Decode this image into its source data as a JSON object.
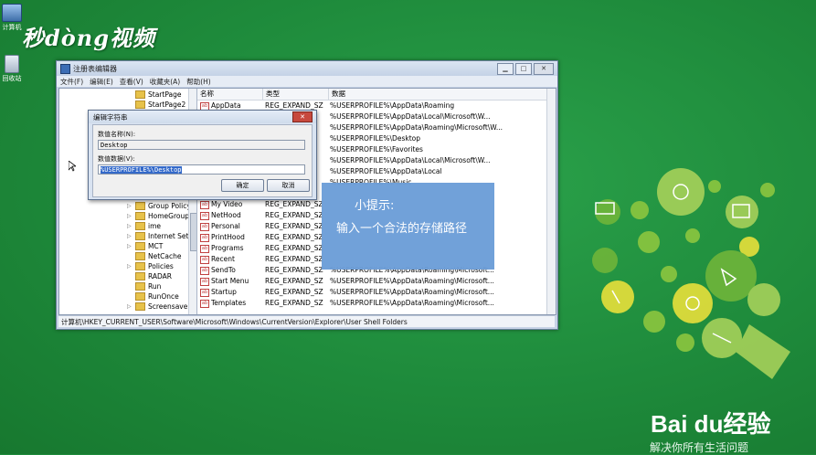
{
  "desktop": {
    "icons": [
      {
        "label": "计算机",
        "icon": "computer-icon"
      },
      {
        "label": "回收站",
        "icon": "recycle-bin-icon"
      }
    ],
    "logo_text": "秒dòng视频",
    "baidu_brand": "Bai du经验",
    "baidu_slogan": "解决你所有生活问题"
  },
  "window": {
    "title": "注册表编辑器",
    "menu": [
      "文件(F)",
      "编辑(E)",
      "查看(V)",
      "收藏夹(A)",
      "帮助(H)"
    ],
    "tree_items": [
      "StartPage",
      "StartPage2",
      "Group Policy",
      "HomeGroup",
      "ime",
      "Internet Settin",
      "MCT",
      "NetCache",
      "Policies",
      "RADAR",
      "Run",
      "RunOnce",
      "Screensavers"
    ],
    "columns": {
      "name": "名称",
      "type": "类型",
      "data": "数据"
    },
    "rows": [
      {
        "name": "AppData",
        "type": "REG_EXPAND_SZ",
        "data": "%USERPROFILE%\\AppData\\Roaming"
      },
      {
        "name": "",
        "type": "SZ",
        "data": "%USERPROFILE%\\AppData\\Local\\Microsoft\\W..."
      },
      {
        "name": "",
        "type": "SZ",
        "data": "%USERPROFILE%\\AppData\\Roaming\\Microsoft\\W..."
      },
      {
        "name": "",
        "type": "SZ",
        "data": "%USERPROFILE%\\Desktop"
      },
      {
        "name": "",
        "type": "SZ",
        "data": "%USERPROFILE%\\Favorites"
      },
      {
        "name": "",
        "type": "SZ",
        "data": "%USERPROFILE%\\AppData\\Local\\Microsoft\\W..."
      },
      {
        "name": "",
        "type": "SZ",
        "data": "%USERPROFILE%\\AppData\\Local"
      },
      {
        "name": "",
        "type": "SZ",
        "data": "%USERPROFILE%\\Music"
      },
      {
        "name": "",
        "type": "SZ",
        "data": ""
      },
      {
        "name": "My Video",
        "type": "REG_EXPAND_SZ",
        "data": ""
      },
      {
        "name": "NetHood",
        "type": "REG_EXPAND_SZ",
        "data": ""
      },
      {
        "name": "Personal",
        "type": "REG_EXPAND_SZ",
        "data": ""
      },
      {
        "name": "PrintHood",
        "type": "REG_EXPAND_SZ",
        "data": ""
      },
      {
        "name": "Programs",
        "type": "REG_EXPAND_SZ",
        "data": ""
      },
      {
        "name": "Recent",
        "type": "REG_EXPAND_SZ",
        "data": ""
      },
      {
        "name": "SendTo",
        "type": "REG_EXPAND_SZ",
        "data": "%USERPROFILE%\\AppData\\Roaming\\Microsoft..."
      },
      {
        "name": "Start Menu",
        "type": "REG_EXPAND_SZ",
        "data": "%USERPROFILE%\\AppData\\Roaming\\Microsoft..."
      },
      {
        "name": "Startup",
        "type": "REG_EXPAND_SZ",
        "data": "%USERPROFILE%\\AppData\\Roaming\\Microsoft..."
      },
      {
        "name": "Templates",
        "type": "REG_EXPAND_SZ",
        "data": "%USERPROFILE%\\AppData\\Roaming\\Microsoft..."
      }
    ],
    "status_path": "计算机\\HKEY_CURRENT_USER\\Software\\Microsoft\\Windows\\CurrentVersion\\Explorer\\User Shell Folders"
  },
  "dialog": {
    "title": "编辑字符串",
    "name_label": "数值名称(N):",
    "name_value": "Desktop",
    "data_label": "数值数据(V):",
    "data_value": "%USERPROFILE%\\Desktop",
    "ok_label": "确定",
    "cancel_label": "取消"
  },
  "tip": {
    "title": "小提示:",
    "body": "输入一个合法的存储路径"
  }
}
